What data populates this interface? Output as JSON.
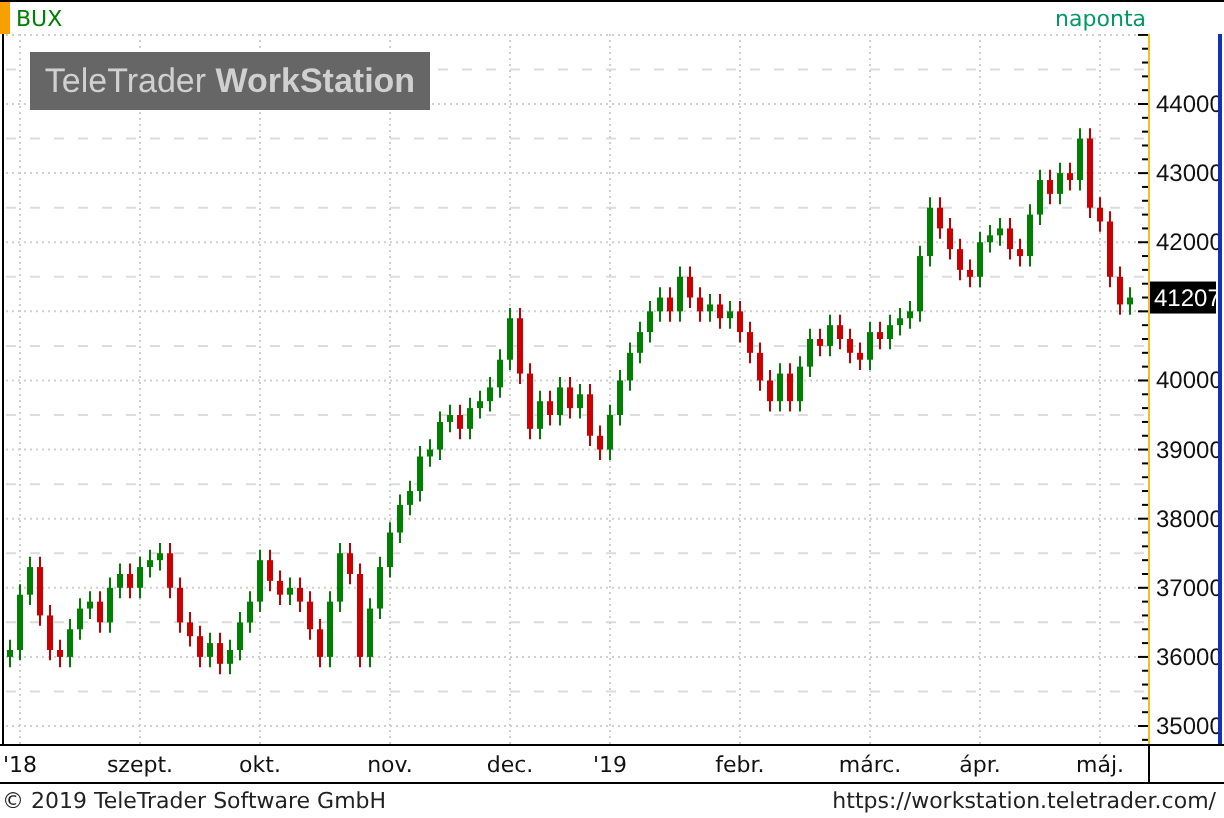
{
  "header": {
    "interval": "naponta"
  },
  "watermark": "TeleTrader **WorkStation**",
  "chart": {
    "last_price": "41207",
    "chart_data": {
      "type": "candlestick",
      "title": "BUX",
      "categories": [
        null,
        "'18",
        null,
        null,
        null,
        null,
        null,
        null,
        null,
        null,
        null,
        null,
        null,
        "szept.",
        null,
        null,
        null,
        null,
        null,
        null,
        null,
        null,
        null,
        null,
        null,
        "okt.",
        null,
        null,
        null,
        null,
        null,
        null,
        null,
        null,
        null,
        null,
        null,
        null,
        "nov.",
        null,
        null,
        null,
        null,
        null,
        null,
        null,
        null,
        null,
        null,
        null,
        "dec.",
        null,
        null,
        null,
        null,
        null,
        null,
        null,
        null,
        null,
        "'19",
        null,
        null,
        null,
        null,
        null,
        null,
        null,
        null,
        null,
        null,
        null,
        null,
        "febr.",
        null,
        null,
        null,
        null,
        null,
        null,
        null,
        null,
        null,
        null,
        null,
        null,
        "márc.",
        null,
        null,
        null,
        null,
        null,
        null,
        null,
        null,
        null,
        null,
        "ápr.",
        null,
        null,
        null,
        null,
        null,
        null,
        null,
        null,
        null,
        null,
        null,
        "máj.",
        null,
        null,
        null
      ],
      "ohlc": [
        [
          36000,
          36250,
          35850,
          36100
        ],
        [
          36100,
          37050,
          35950,
          36900
        ],
        [
          36900,
          37450,
          36750,
          37300
        ],
        [
          37300,
          37450,
          36450,
          36600
        ],
        [
          36600,
          36750,
          35950,
          36100
        ],
        [
          36100,
          36250,
          35850,
          36000
        ],
        [
          36000,
          36550,
          35850,
          36400
        ],
        [
          36400,
          36850,
          36250,
          36700
        ],
        [
          36700,
          36950,
          36550,
          36800
        ],
        [
          36800,
          36950,
          36350,
          36500
        ],
        [
          36500,
          37150,
          36350,
          37000
        ],
        [
          37000,
          37350,
          36850,
          37200
        ],
        [
          37200,
          37350,
          36850,
          37000
        ],
        [
          37000,
          37450,
          36850,
          37300
        ],
        [
          37300,
          37550,
          37150,
          37400
        ],
        [
          37400,
          37650,
          37250,
          37500
        ],
        [
          37500,
          37650,
          36850,
          37000
        ],
        [
          37000,
          37150,
          36350,
          36500
        ],
        [
          36500,
          36650,
          36150,
          36300
        ],
        [
          36300,
          36450,
          35850,
          36000
        ],
        [
          36000,
          36350,
          35850,
          36200
        ],
        [
          36200,
          36350,
          35750,
          35900
        ],
        [
          35900,
          36250,
          35750,
          36100
        ],
        [
          36100,
          36650,
          35950,
          36500
        ],
        [
          36500,
          36950,
          36350,
          36800
        ],
        [
          36800,
          37550,
          36650,
          37400
        ],
        [
          37400,
          37550,
          36950,
          37100
        ],
        [
          37100,
          37250,
          36750,
          36900
        ],
        [
          36900,
          37150,
          36750,
          37000
        ],
        [
          37000,
          37150,
          36650,
          36800
        ],
        [
          36800,
          36950,
          36250,
          36400
        ],
        [
          36400,
          36550,
          35850,
          36000
        ],
        [
          36000,
          36950,
          35850,
          36800
        ],
        [
          36800,
          37650,
          36650,
          37500
        ],
        [
          37500,
          37650,
          37050,
          37200
        ],
        [
          37200,
          37350,
          35850,
          36000
        ],
        [
          36000,
          36850,
          35850,
          36700
        ],
        [
          36700,
          37450,
          36550,
          37300
        ],
        [
          37300,
          37950,
          37150,
          37800
        ],
        [
          37800,
          38350,
          37650,
          38200
        ],
        [
          38200,
          38550,
          38050,
          38400
        ],
        [
          38400,
          39050,
          38250,
          38900
        ],
        [
          38900,
          39150,
          38750,
          39000
        ],
        [
          39000,
          39550,
          38850,
          39400
        ],
        [
          39400,
          39650,
          39250,
          39500
        ],
        [
          39500,
          39650,
          39150,
          39300
        ],
        [
          39300,
          39750,
          39150,
          39600
        ],
        [
          39600,
          39850,
          39450,
          39700
        ],
        [
          39700,
          40050,
          39550,
          39900
        ],
        [
          39900,
          40450,
          39750,
          40300
        ],
        [
          40300,
          41050,
          40150,
          40900
        ],
        [
          40900,
          41050,
          39950,
          40100
        ],
        [
          40100,
          40250,
          39150,
          39300
        ],
        [
          39300,
          39850,
          39150,
          39700
        ],
        [
          39700,
          39850,
          39350,
          39500
        ],
        [
          39500,
          40050,
          39350,
          39900
        ],
        [
          39900,
          40050,
          39450,
          39600
        ],
        [
          39600,
          39950,
          39450,
          39800
        ],
        [
          39800,
          39950,
          39050,
          39200
        ],
        [
          39200,
          39350,
          38850,
          39000
        ],
        [
          39000,
          39650,
          38850,
          39500
        ],
        [
          39500,
          40150,
          39350,
          40000
        ],
        [
          40000,
          40550,
          39850,
          40400
        ],
        [
          40400,
          40850,
          40250,
          40700
        ],
        [
          40700,
          41150,
          40550,
          41000
        ],
        [
          41000,
          41350,
          40850,
          41200
        ],
        [
          41200,
          41350,
          40850,
          41000
        ],
        [
          41000,
          41650,
          40850,
          41500
        ],
        [
          41500,
          41650,
          41050,
          41200
        ],
        [
          41200,
          41350,
          40850,
          41000
        ],
        [
          41000,
          41250,
          40850,
          41100
        ],
        [
          41100,
          41250,
          40750,
          40900
        ],
        [
          40900,
          41150,
          40750,
          41000
        ],
        [
          41000,
          41150,
          40550,
          40700
        ],
        [
          40700,
          40850,
          40250,
          40400
        ],
        [
          40400,
          40550,
          39850,
          40000
        ],
        [
          40000,
          40150,
          39550,
          39700
        ],
        [
          39700,
          40250,
          39550,
          40100
        ],
        [
          40100,
          40250,
          39550,
          39700
        ],
        [
          39700,
          40350,
          39550,
          40200
        ],
        [
          40200,
          40750,
          40050,
          40600
        ],
        [
          40600,
          40750,
          40350,
          40500
        ],
        [
          40500,
          40950,
          40350,
          40800
        ],
        [
          40800,
          40950,
          40450,
          40600
        ],
        [
          40600,
          40750,
          40250,
          40400
        ],
        [
          40400,
          40550,
          40150,
          40300
        ],
        [
          40300,
          40850,
          40150,
          40700
        ],
        [
          40700,
          40850,
          40450,
          40600
        ],
        [
          40600,
          40950,
          40450,
          40800
        ],
        [
          40800,
          41050,
          40650,
          40900
        ],
        [
          40900,
          41150,
          40750,
          41000
        ],
        [
          41000,
          41950,
          40850,
          41800
        ],
        [
          41800,
          42650,
          41650,
          42500
        ],
        [
          42500,
          42650,
          42050,
          42200
        ],
        [
          42200,
          42350,
          41750,
          41900
        ],
        [
          41900,
          42050,
          41450,
          41600
        ],
        [
          41600,
          41750,
          41350,
          41500
        ],
        [
          41500,
          42150,
          41350,
          42000
        ],
        [
          42000,
          42250,
          41850,
          42100
        ],
        [
          42100,
          42350,
          41950,
          42200
        ],
        [
          42200,
          42350,
          41750,
          41900
        ],
        [
          41900,
          42050,
          41650,
          41800
        ],
        [
          41800,
          42550,
          41650,
          42400
        ],
        [
          42400,
          43050,
          42250,
          42900
        ],
        [
          42900,
          43050,
          42550,
          42700
        ],
        [
          42700,
          43150,
          42550,
          43000
        ],
        [
          43000,
          43150,
          42750,
          42900
        ],
        [
          42900,
          43650,
          42750,
          43500
        ],
        [
          43500,
          43650,
          42350,
          42500
        ],
        [
          42500,
          42650,
          42150,
          42300
        ],
        [
          42300,
          42450,
          41350,
          41500
        ],
        [
          41500,
          41650,
          40950,
          41100
        ],
        [
          41100,
          41350,
          40950,
          41200
        ]
      ],
      "grid": true,
      "ylim": [
        34740,
        45013
      ],
      "yticks": [
        35000,
        36000,
        37000,
        38000,
        39000,
        40000,
        42000,
        43000,
        44000
      ]
    }
  },
  "footer": {
    "copyright": "© 2019 TeleTrader Software GmbH",
    "url": "https://workstation.teletrader.com/"
  }
}
